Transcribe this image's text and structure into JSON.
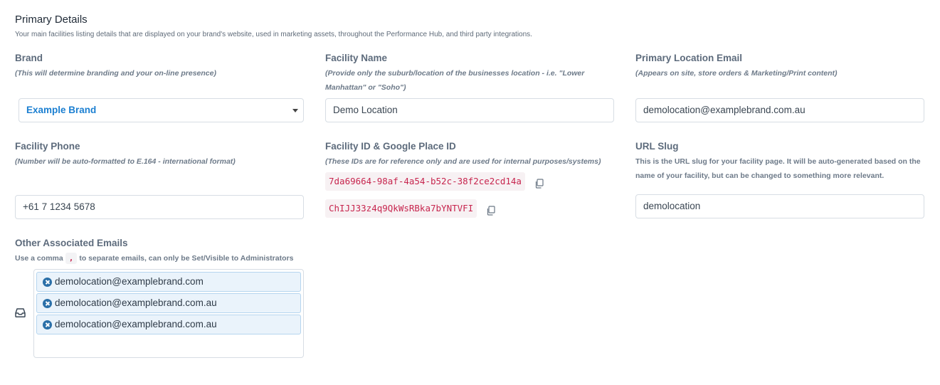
{
  "section": {
    "title": "Primary Details",
    "description": "Your main facilities listing details that are displayed on your brand's website, used in marketing assets, throughout the Performance Hub, and third party integrations."
  },
  "brand": {
    "label": "Brand",
    "hint": "(This will determine branding and your on-line presence)",
    "value": "Example Brand"
  },
  "facility_name": {
    "label": "Facility Name",
    "hint": "(Provide only the suburb/location of the businesses location - i.e. \"Lower Manhattan\" or \"Soho\")",
    "value": "Demo Location"
  },
  "primary_email": {
    "label": "Primary Location Email",
    "hint": "(Appears on site, store orders & Marketing/Print content)",
    "value": "demolocation@examplebrand.com.au"
  },
  "facility_phone": {
    "label": "Facility Phone",
    "hint": "(Number will be auto-formatted to E.164 - international format)",
    "value": "+61 7 1234 5678"
  },
  "facility_ids": {
    "label": "Facility ID & Google Place ID",
    "hint": "(These IDs are for reference only and are used for internal purposes/systems)",
    "facility_id": "7da69664-98af-4a54-b52c-38f2ce2cd14a",
    "google_place_id": "ChIJJ33z4q9QkWsRBka7bYNTVFI"
  },
  "url_slug": {
    "label": "URL Slug",
    "hint": "This is the URL slug for your facility page. It will be auto-generated based on the name of your facility, but can be changed to something more relevant.",
    "value": "demolocation"
  },
  "other_emails": {
    "label": "Other Associated Emails",
    "hint_before": "Use a comma",
    "hint_code": ",",
    "hint_after": "to separate emails, can only be Set/Visible to Administrators",
    "tags": [
      "demolocation@examplebrand.com",
      "demolocation@examplebrand.com.au",
      "demolocation@examplebrand.com.au"
    ]
  },
  "icons": {
    "copy": "copy-icon",
    "remove": "close-circle-icon",
    "inbox": "inbox-icon"
  }
}
